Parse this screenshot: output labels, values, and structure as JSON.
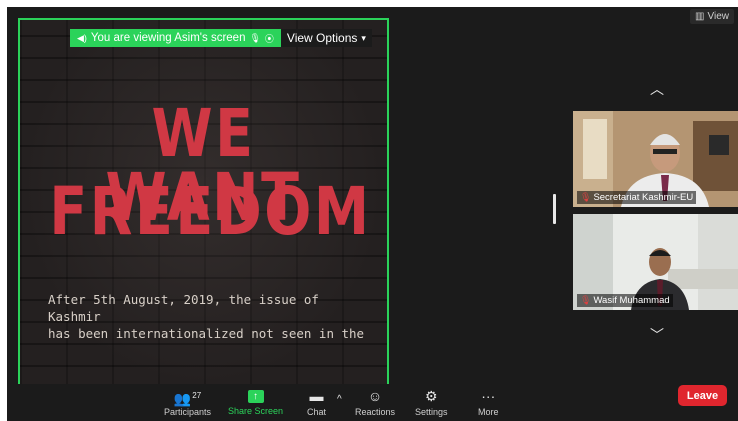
{
  "share": {
    "viewing_text": "You are viewing Asim's screen",
    "view_options": "View Options",
    "headline_1": "WE WANT",
    "headline_2": "FREEDOM",
    "caption_1": "After 5th August, 2019, the issue of Kashmir",
    "caption_2": "has been internationalized not seen in the"
  },
  "top_view": "View",
  "participants": [
    {
      "name": "Secretariat Kashmir-EU"
    },
    {
      "name": "Wasif Muhammad"
    }
  ],
  "toolbar": {
    "participants_label": "Participants",
    "participants_count": "27",
    "share_label": "Share Screen",
    "chat_label": "Chat",
    "reactions_label": "Reactions",
    "settings_label": "Settings",
    "more_label": "More",
    "leave_label": "Leave"
  },
  "colors": {
    "accent_green": "#2bd35a",
    "leave_red": "#e0262e",
    "headline_red": "#d03844"
  }
}
